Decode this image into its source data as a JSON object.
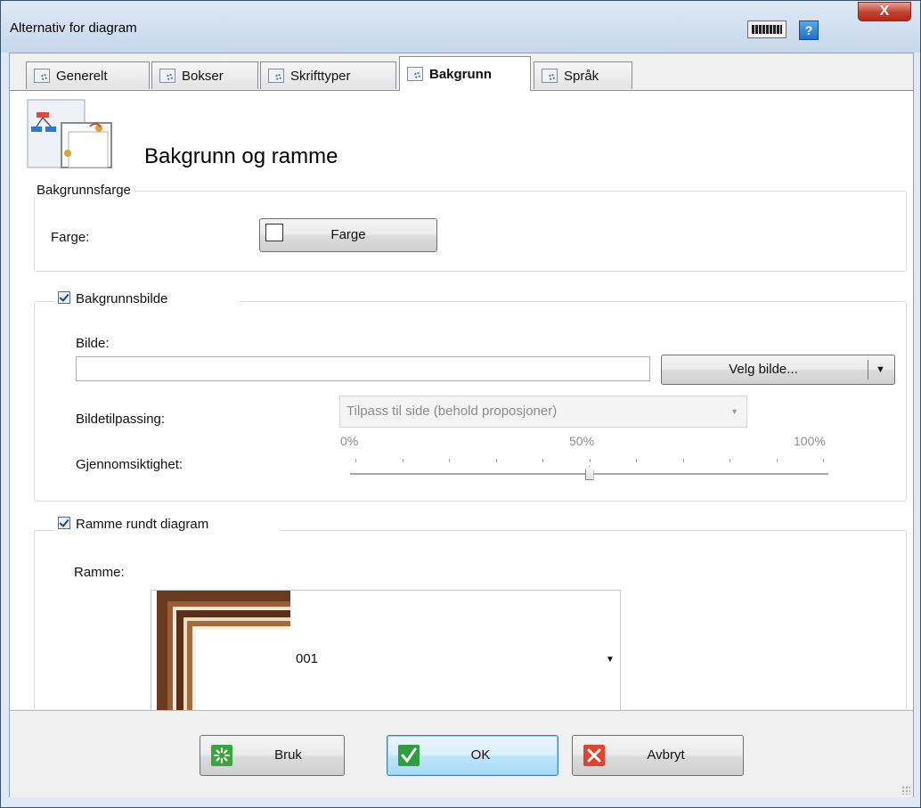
{
  "window": {
    "title": "Alternativ for diagram",
    "close_label": "X",
    "help_label": "?"
  },
  "tabs": [
    {
      "label": "Generelt"
    },
    {
      "label": "Bokser"
    },
    {
      "label": "Skrifttyper"
    },
    {
      "label": "Bakgrunn"
    },
    {
      "label": "Språk"
    }
  ],
  "page": {
    "title": "Bakgrunn og ramme"
  },
  "bg_color": {
    "group_title": "Bakgrunnsfarge",
    "label": "Farge:",
    "button_label": "Farge"
  },
  "bg_image": {
    "group_title": "Bakgrunnsbilde",
    "enabled": true,
    "image_label": "Bilde:",
    "image_value": "",
    "choose_button": "Velg bilde...",
    "fit_label": "Bildetilpassing:",
    "fit_value": "Tilpass til side (behold proposjoner)",
    "transparency_label": "Gjennomsiktighet:",
    "scale_min": "0%",
    "scale_mid": "50%",
    "scale_max": "100%",
    "transparency_value": 50
  },
  "frame": {
    "group_title": "Ramme rundt diagram",
    "enabled": true,
    "frame_label": "Ramme:",
    "frame_value": "001"
  },
  "buttons": {
    "apply": "Bruk",
    "ok": "OK",
    "cancel": "Avbryt"
  }
}
